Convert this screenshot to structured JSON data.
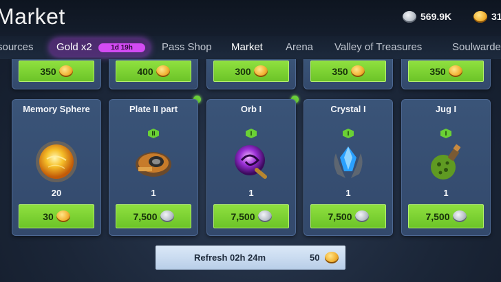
{
  "header": {
    "title": "Market",
    "currencies": [
      {
        "value": "569.9K",
        "icon": "silver-coin-icon"
      },
      {
        "value": "31",
        "icon": "gold-coin-icon"
      }
    ]
  },
  "tabs": [
    {
      "label": "sources"
    },
    {
      "label": "Gold x2",
      "badge": "1d 19h"
    },
    {
      "label": "Pass Shop"
    },
    {
      "label": "Market",
      "active": true
    },
    {
      "label": "Arena"
    },
    {
      "label": "Valley of Treasures"
    },
    {
      "label": "Soulwarden"
    }
  ],
  "top_row": [
    {
      "price": "350",
      "currency": "gold"
    },
    {
      "price": "400",
      "currency": "gold"
    },
    {
      "price": "300",
      "currency": "gold"
    },
    {
      "price": "350",
      "currency": "gold"
    },
    {
      "price": "350",
      "currency": "gold"
    }
  ],
  "items": [
    {
      "name": "Memory Sphere",
      "quantity": "20",
      "price": "30",
      "currency": "gold",
      "level": ""
    },
    {
      "name": "Plate II part",
      "quantity": "1",
      "price": "7,500",
      "currency": "silver",
      "level": "II"
    },
    {
      "name": "Orb I",
      "quantity": "1",
      "price": "7,500",
      "currency": "silver",
      "level": "I"
    },
    {
      "name": "Crystal I",
      "quantity": "1",
      "price": "7,500",
      "currency": "silver",
      "level": "I"
    },
    {
      "name": "Jug  I",
      "quantity": "1",
      "price": "7,500",
      "currency": "silver",
      "level": "I"
    }
  ],
  "refresh": {
    "label": "Refresh 02h 24m",
    "cost": "50"
  },
  "colors": {
    "accent_green": "#7ad232",
    "gold_tab": "#d34bf3",
    "card_bg": "#3a5478"
  }
}
